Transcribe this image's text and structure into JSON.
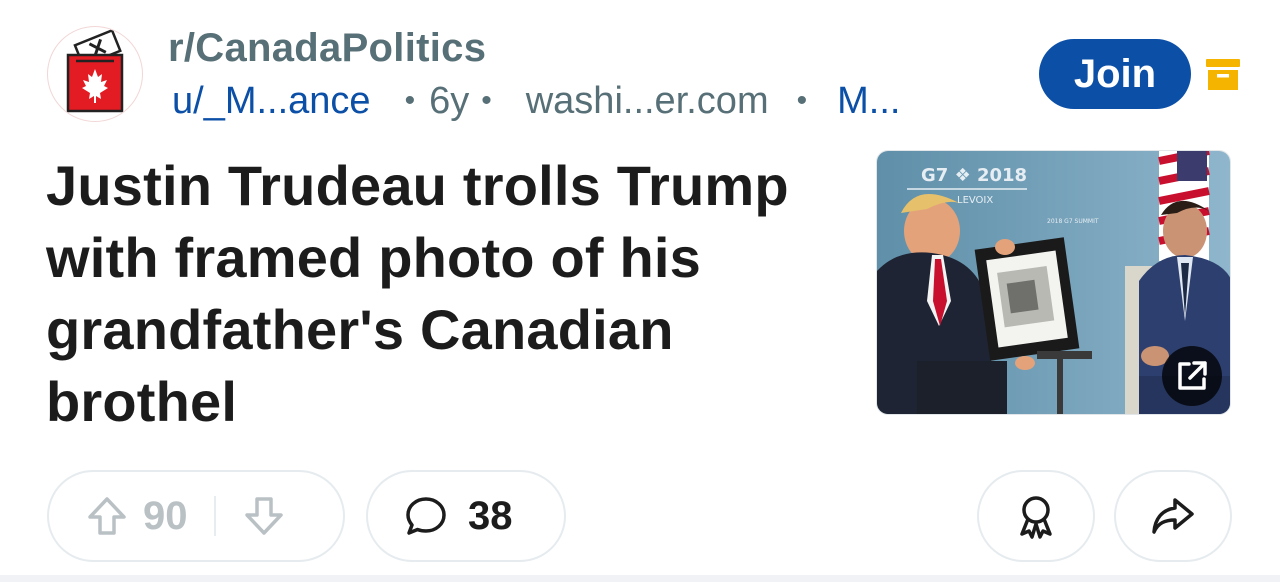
{
  "post": {
    "subreddit": "r/CanadaPolitics",
    "author": "u/_M...ance",
    "age": "6y",
    "domain": "washi...er.com",
    "more": "M...",
    "join_label": "Join",
    "title": "Justin Trudeau trolls Trump with framed photo of his grandfather's Canadian brothel"
  },
  "thumbnail": {
    "banner_text": "G7 ❖ 2018",
    "banner_sub": "LEVOIX",
    "side_text": "2018 G7 SUMMIT"
  },
  "actions": {
    "upvotes": "90",
    "comments": "38"
  },
  "colors": {
    "accent_blue": "#0b4fa7",
    "archive_yellow": "#f5b400",
    "flag_red": "#e31b23"
  },
  "icons": [
    "ballot-box-icon",
    "archive-icon",
    "external-link-icon",
    "upvote-icon",
    "downvote-icon",
    "comment-icon",
    "award-icon",
    "share-icon"
  ]
}
